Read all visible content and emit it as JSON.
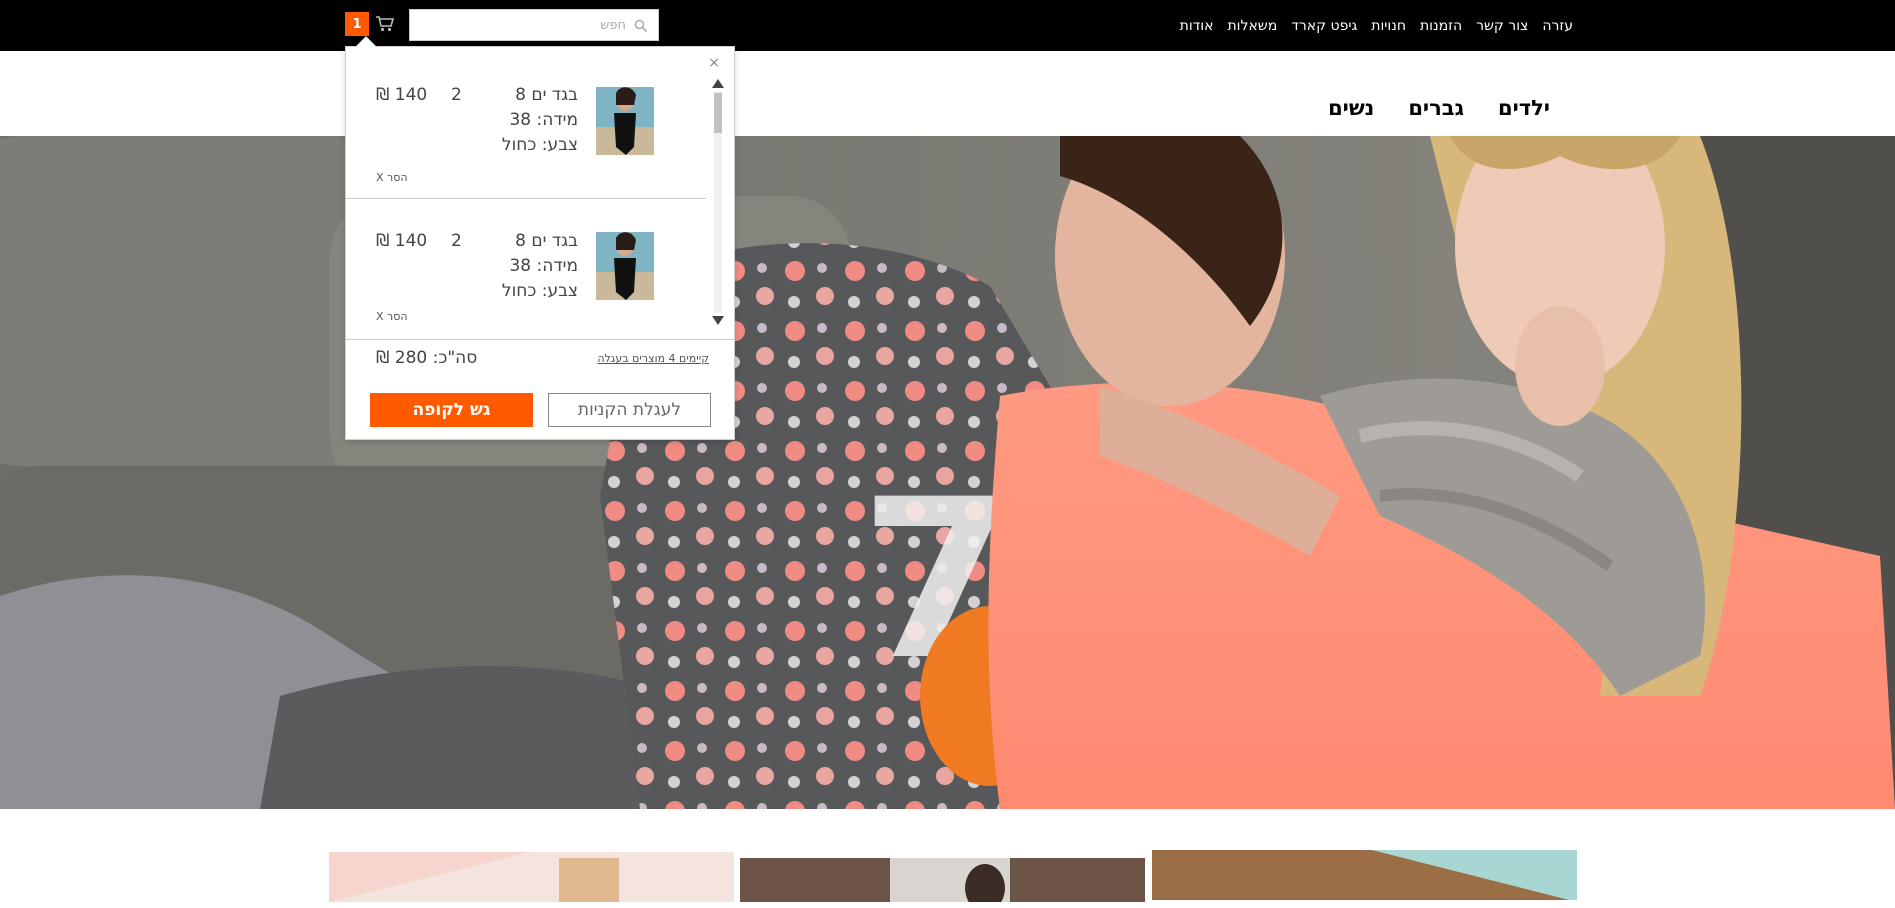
{
  "topnav": {
    "items": [
      "אודות",
      "משאלות",
      "גיפט קארד",
      "חנויות",
      "הזמנות",
      "צור קשר",
      "עזרה"
    ]
  },
  "cart": {
    "count": "1"
  },
  "search": {
    "placeholder": "חפש"
  },
  "mainnav": {
    "items": [
      "נשים",
      "גברים",
      "ילדים"
    ]
  },
  "cart_popup": {
    "close": "×",
    "items": [
      {
        "name": "בגד ים 8",
        "size": "מידה: 38",
        "color": "צבע: כחול",
        "qty": "2",
        "price": "140 ₪",
        "remove": "הסר X"
      },
      {
        "name": "בגד ים 8",
        "size": "מידה: 38",
        "color": "צבע: כחול",
        "qty": "2",
        "price": "140 ₪",
        "remove": "הסר X"
      }
    ],
    "total": "סה\"כ: 280 ₪",
    "more_link": "קיימים 4 מוצרים בעגלה",
    "checkout_label": "גש לקופה",
    "cart_label": "לעגלת הקניות"
  },
  "colors": {
    "accent": "#ff5a00",
    "topbar": "#000000"
  }
}
